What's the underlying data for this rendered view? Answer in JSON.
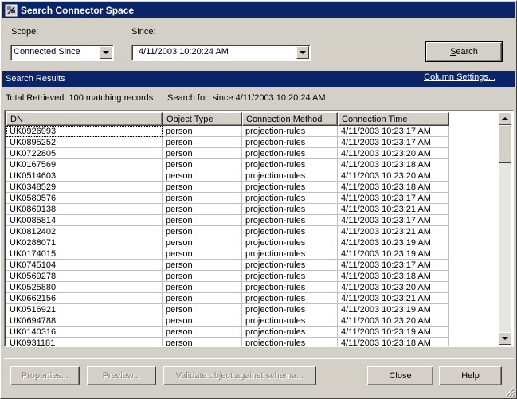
{
  "window": {
    "title": "Search Connector Space",
    "icon": "connector-space-icon"
  },
  "scope": {
    "label": "Scope:",
    "value": "Connected Since"
  },
  "since": {
    "label": "Since:",
    "value": "4/11/2003 10:20:24 AM"
  },
  "search_button": {
    "label_pre": "",
    "label_u": "S",
    "label_post": "earch"
  },
  "results": {
    "header": "Search Results",
    "column_settings": "Column Settings...",
    "total_retrieved": "Total Retrieved: 100 matching records",
    "search_for": "Search for:  since 4/11/2003 10:20:24 AM"
  },
  "columns": [
    "DN",
    "Object Type",
    "Connection Method",
    "Connection Time"
  ],
  "rows": [
    [
      "UK0926993",
      "person",
      "projection-rules",
      "4/11/2003 10:23:17 AM"
    ],
    [
      "UK0895252",
      "person",
      "projection-rules",
      "4/11/2003 10:23:17 AM"
    ],
    [
      "UK0722805",
      "person",
      "projection-rules",
      "4/11/2003 10:23:20 AM"
    ],
    [
      "UK0167569",
      "person",
      "projection-rules",
      "4/11/2003 10:23:18 AM"
    ],
    [
      "UK0514603",
      "person",
      "projection-rules",
      "4/11/2003 10:23:20 AM"
    ],
    [
      "UK0348529",
      "person",
      "projection-rules",
      "4/11/2003 10:23:18 AM"
    ],
    [
      "UK0580576",
      "person",
      "projection-rules",
      "4/11/2003 10:23:17 AM"
    ],
    [
      "UK0869138",
      "person",
      "projection-rules",
      "4/11/2003 10:23:21 AM"
    ],
    [
      "UK0085814",
      "person",
      "projection-rules",
      "4/11/2003 10:23:17 AM"
    ],
    [
      "UK0812402",
      "person",
      "projection-rules",
      "4/11/2003 10:23:21 AM"
    ],
    [
      "UK0288071",
      "person",
      "projection-rules",
      "4/11/2003 10:23:19 AM"
    ],
    [
      "UK0174015",
      "person",
      "projection-rules",
      "4/11/2003 10:23:19 AM"
    ],
    [
      "UK0745104",
      "person",
      "projection-rules",
      "4/11/2003 10:23:17 AM"
    ],
    [
      "UK0569278",
      "person",
      "projection-rules",
      "4/11/2003 10:23:18 AM"
    ],
    [
      "UK0525880",
      "person",
      "projection-rules",
      "4/11/2003 10:23:20 AM"
    ],
    [
      "UK0662156",
      "person",
      "projection-rules",
      "4/11/2003 10:23:21 AM"
    ],
    [
      "UK0516921",
      "person",
      "projection-rules",
      "4/11/2003 10:23:19 AM"
    ],
    [
      "UK0694788",
      "person",
      "projection-rules",
      "4/11/2003 10:23:20 AM"
    ],
    [
      "UK0140316",
      "person",
      "projection-rules",
      "4/11/2003 10:23:19 AM"
    ],
    [
      "UK0931181",
      "person",
      "projection-rules",
      "4/11/2003 10:23:18 AM"
    ]
  ],
  "buttons": {
    "properties": "Properties...",
    "preview": "Preview...",
    "validate": "Validate object against schema...",
    "close": "Close",
    "help": "Help"
  },
  "colors": {
    "titlebar": "#0a246a",
    "face": "#d4d0c8"
  }
}
